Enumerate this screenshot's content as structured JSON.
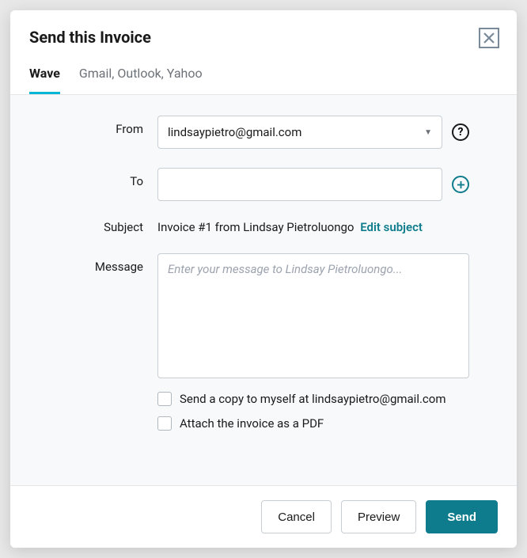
{
  "title": "Send this Invoice",
  "tabs": {
    "wave": "Wave",
    "other": "Gmail, Outlook, Yahoo"
  },
  "labels": {
    "from": "From",
    "to": "To",
    "subject": "Subject",
    "message": "Message"
  },
  "from": {
    "value": "lindsaypietro@gmail.com"
  },
  "to": {
    "value": ""
  },
  "subject": {
    "text": "Invoice #1 from Lindsay Pietroluongo",
    "edit_link": "Edit subject"
  },
  "message": {
    "placeholder": "Enter your message to Lindsay Pietroluongo..."
  },
  "checkboxes": {
    "send_copy": "Send a copy to myself at lindsaypietro@gmail.com",
    "attach_pdf": "Attach the invoice as a PDF"
  },
  "buttons": {
    "cancel": "Cancel",
    "preview": "Preview",
    "send": "Send"
  }
}
